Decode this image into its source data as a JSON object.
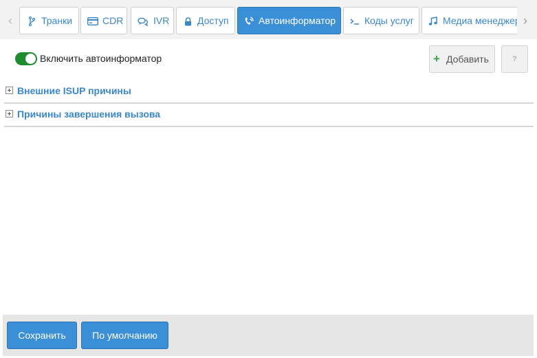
{
  "tabs": {
    "items": [
      {
        "label": "Транки",
        "icon": "branch-icon"
      },
      {
        "label": "CDR",
        "icon": "credit-card-icon"
      },
      {
        "label": "IVR",
        "icon": "comments-icon"
      },
      {
        "label": "Доступ",
        "icon": "lock-icon"
      },
      {
        "label": "Автоинформатор",
        "icon": "phone-volume-icon",
        "active": true
      },
      {
        "label": "Коды услуг",
        "icon": "terminal-icon"
      },
      {
        "label": "Медиа менеджер",
        "icon": "music-icon"
      }
    ]
  },
  "toolbar": {
    "toggle_label": "Включить автоинформатор",
    "toggle_on": true,
    "add_label": "Добавить",
    "help_label": "?"
  },
  "sections": [
    {
      "title": "Внешние ISUP причины"
    },
    {
      "title": "Причины завершения вызова"
    }
  ],
  "footer": {
    "save_label": "Сохранить",
    "default_label": "По умолчанию"
  },
  "colors": {
    "accent": "#3a8fd6",
    "link": "#3a87c8",
    "toggle_on": "#1e8c2e",
    "add_icon": "#3aa54a"
  }
}
